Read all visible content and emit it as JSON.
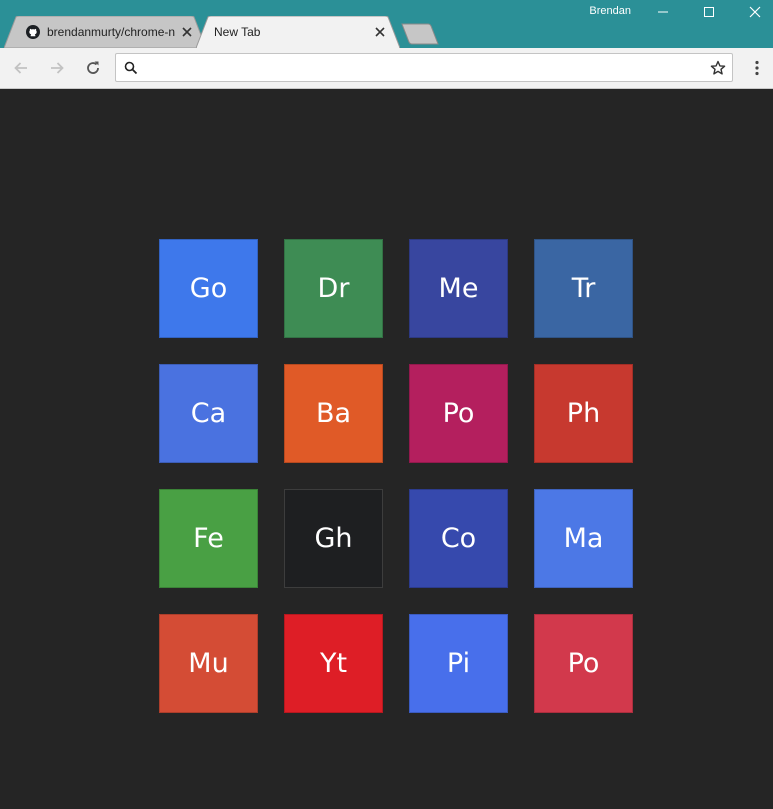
{
  "window": {
    "user_name": "Brendan",
    "icons": {
      "minimize": "minimize-icon",
      "maximize": "maximize-icon",
      "close": "close-icon"
    }
  },
  "tabs": [
    {
      "title": "brendanmurty/chrome-n",
      "favicon": "github-icon",
      "active": false
    },
    {
      "title": "New Tab",
      "favicon": "",
      "active": true
    }
  ],
  "toolbar": {
    "omnibox_value": "",
    "icons": {
      "back": "back-arrow-icon",
      "forward": "forward-arrow-icon",
      "reload": "reload-icon",
      "search": "search-icon",
      "bookmark": "star-icon",
      "menu": "kebab-menu-icon"
    }
  },
  "colors": {
    "titlebar": "#2b9097",
    "page_background": "#252525"
  },
  "tiles": [
    {
      "label": "Go",
      "color": "#3e78eb"
    },
    {
      "label": "Dr",
      "color": "#3e8c54"
    },
    {
      "label": "Me",
      "color": "#38469f"
    },
    {
      "label": "Tr",
      "color": "#3a66a3"
    },
    {
      "label": "Ca",
      "color": "#4a72e0"
    },
    {
      "label": "Ba",
      "color": "#e05a27"
    },
    {
      "label": "Po",
      "color": "#b41f5e"
    },
    {
      "label": "Ph",
      "color": "#c7392f"
    },
    {
      "label": "Fe",
      "color": "#49a044"
    },
    {
      "label": "Gh",
      "color": "#1e1f21"
    },
    {
      "label": "Co",
      "color": "#3649ad"
    },
    {
      "label": "Ma",
      "color": "#4c78e6"
    },
    {
      "label": "Mu",
      "color": "#d44c35"
    },
    {
      "label": "Yt",
      "color": "#de1e26"
    },
    {
      "label": "Pi",
      "color": "#486feb"
    },
    {
      "label": "Po",
      "color": "#d2394c"
    }
  ]
}
